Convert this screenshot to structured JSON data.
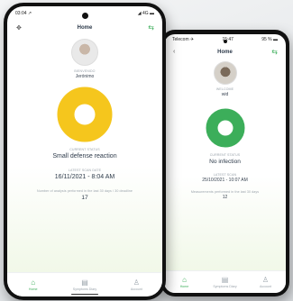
{
  "colors": {
    "accent": "#3cae5a",
    "yellow_status": "#f5c61d",
    "green_status": "#3cae5a"
  },
  "phone_left": {
    "status": {
      "time": "03:04 ↗",
      "right": "◢ 4G ▬"
    },
    "header": {
      "title": "Home",
      "left_icon": "move-icon",
      "right_icon": "swap-icon"
    },
    "user_label": "BIENVENIDO",
    "user_name": "Jerónimo",
    "status_label": "CURRENT STATUS",
    "status_value": "Small defense reaction",
    "status_color": "#f5c61d",
    "date_label": "LATEST SCAN DATE",
    "date_value": "16/11/2021 - 8:04 AM",
    "count_label": "Number of analysis performed in the last 30 days / 30 deadline",
    "count_value": "17",
    "tabs": [
      {
        "label": "Home",
        "icon": "home-icon"
      },
      {
        "label": "Symptoms Diary",
        "icon": "diary-icon"
      },
      {
        "label": "Account",
        "icon": "account-icon"
      }
    ]
  },
  "phone_right": {
    "status": {
      "time": "Telecom ✈",
      "center": "15:47",
      "right": "95 % ▬"
    },
    "header": {
      "title": "Home",
      "left_icon": "back-icon",
      "right_icon": "swap-icon"
    },
    "user_label": "WELCOME",
    "user_name": "wid",
    "status_label": "CURRENT STATUS",
    "status_value": "No infection",
    "status_color": "#3cae5a",
    "date_label": "LATEST SCAN",
    "date_value": "25/10/2021 - 10:07 AM",
    "count_label": "Measurements performed in the last 30 days",
    "count_value": "12",
    "tabs": [
      {
        "label": "Home",
        "icon": "home-icon"
      },
      {
        "label": "Symptoms Diary",
        "icon": "diary-icon"
      },
      {
        "label": "Account",
        "icon": "account-icon"
      }
    ]
  }
}
